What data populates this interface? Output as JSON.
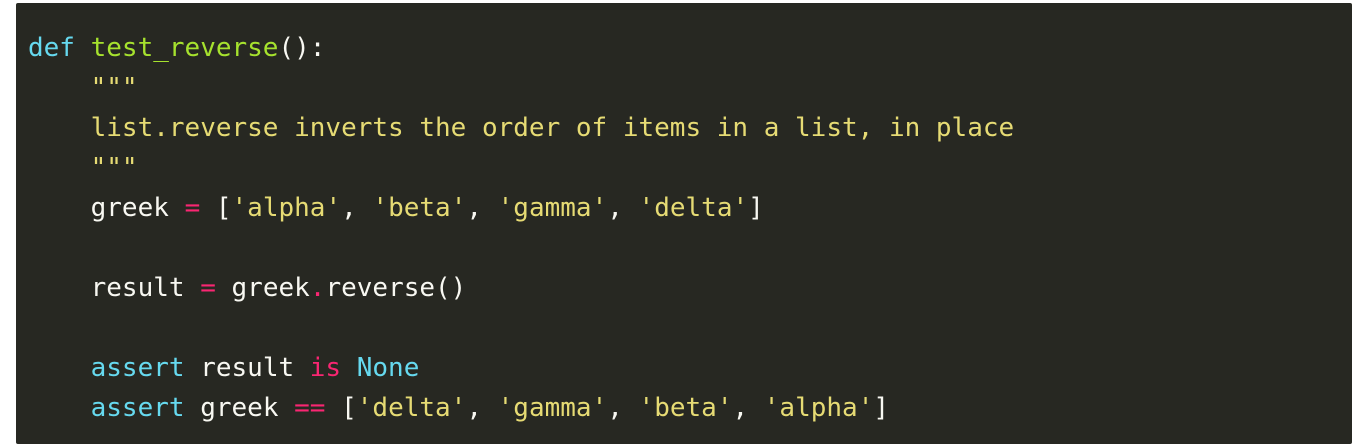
{
  "code": {
    "line1": {
      "kw": "def",
      "name": "test_reverse",
      "rest": "():"
    },
    "line2": "\"\"\"",
    "line3": "list.reverse inverts the order of items in a list, in place",
    "line4": "\"\"\"",
    "line5": {
      "var": "greek",
      "op": "=",
      "open": "[",
      "s1": "'alpha'",
      "s2": "'beta'",
      "s3": "'gamma'",
      "s4": "'delta'",
      "close": "]"
    },
    "line7": {
      "var": "result",
      "op": "=",
      "obj": "greek",
      "dot": ".",
      "call": "reverse()"
    },
    "line9": {
      "kw": "assert",
      "var": "result",
      "is": "is",
      "none": "None"
    },
    "line10": {
      "kw": "assert",
      "var": "greek",
      "op": "==",
      "open": "[",
      "s1": "'delta'",
      "s2": "'gamma'",
      "s3": "'beta'",
      "s4": "'alpha'",
      "close": "]"
    }
  },
  "colors": {
    "background": "#272822",
    "keyword": "#66d9ef",
    "function": "#a6e22e",
    "string": "#e6db74",
    "operator": "#f92672",
    "text": "#f8f8f2"
  }
}
